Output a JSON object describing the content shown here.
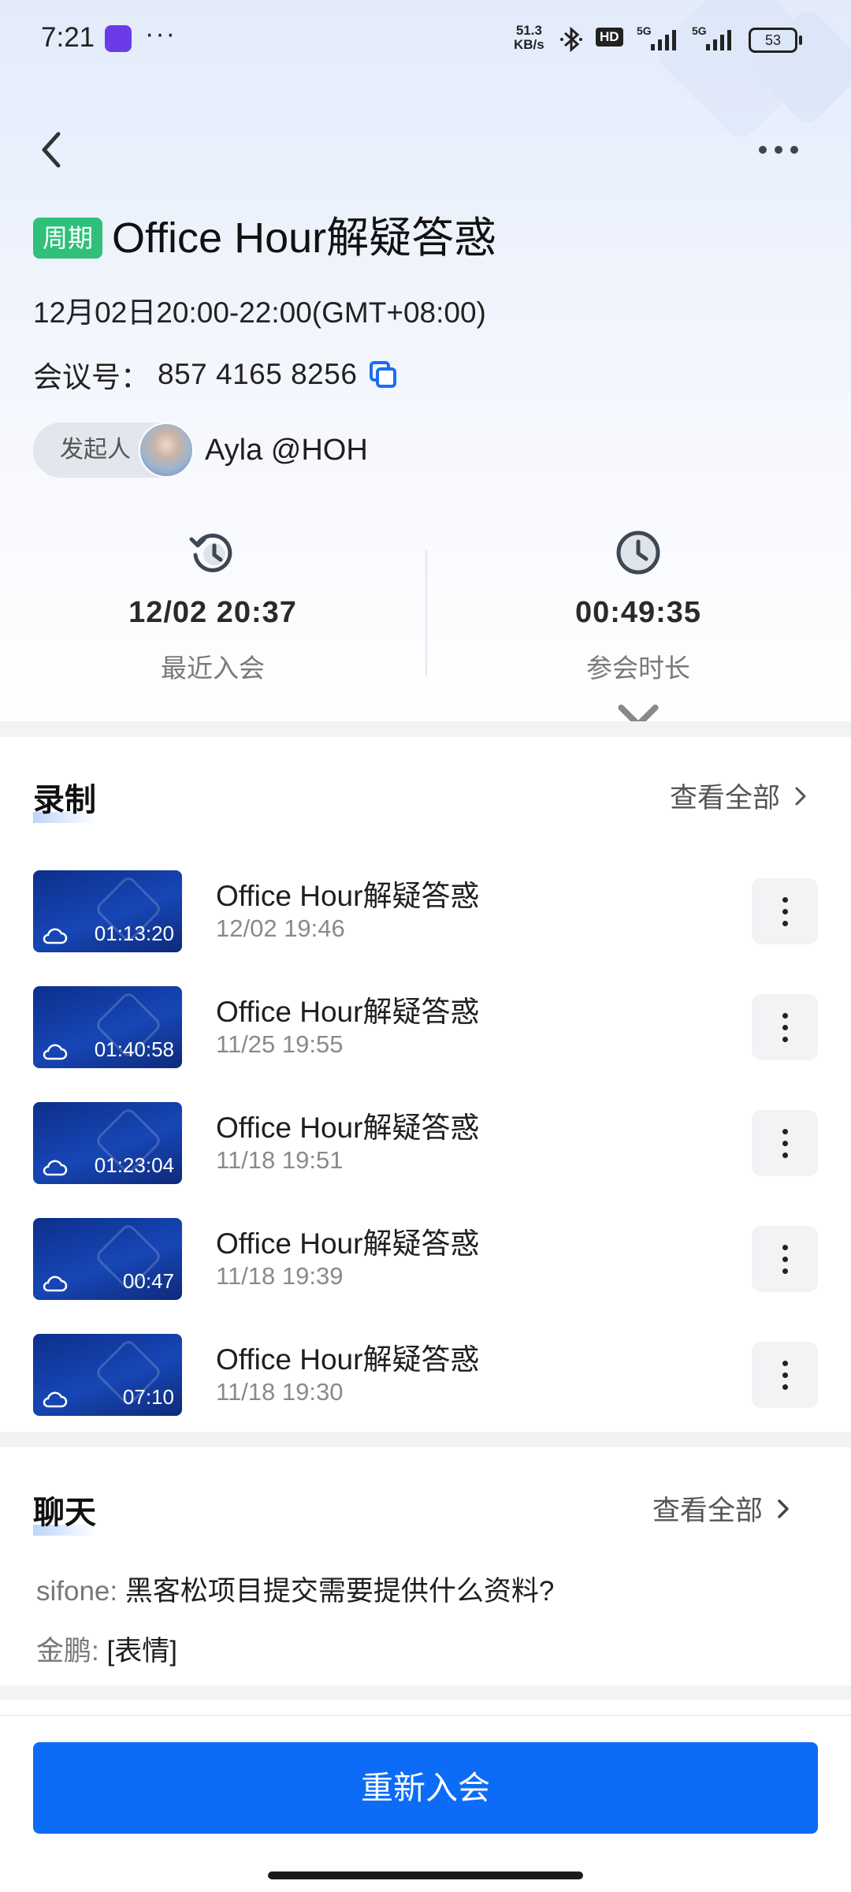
{
  "status_bar": {
    "time": "7:21",
    "more": "···",
    "net_speed_value": "51.3",
    "net_speed_unit": "KB/s",
    "hd": "HD",
    "sim1": "5G",
    "sim2": "5G",
    "battery": "53"
  },
  "header": {
    "back_icon": "chevron-left-icon",
    "more_icon": "more-horizontal-icon"
  },
  "meeting": {
    "tag": "周期",
    "title": "Office Hour解疑答惑",
    "time": "12月02日20:00-22:00(GMT+08:00)",
    "meeting_id_label": "会议号：",
    "meeting_id": "857 4165 8256",
    "host_label": "发起人",
    "host_name": "Ayla @HOH"
  },
  "stats": {
    "recent_join_value": "12/02 20:37",
    "recent_join_label": "最近入会",
    "duration_value": "00:49:35",
    "duration_label": "参会时长"
  },
  "recordings": {
    "title": "录制",
    "view_all": "查看全部",
    "items": [
      {
        "title": "Office Hour解疑答惑",
        "date": "12/02 19:46",
        "duration": "01:13:20"
      },
      {
        "title": "Office Hour解疑答惑",
        "date": "11/25 19:55",
        "duration": "01:40:58"
      },
      {
        "title": "Office Hour解疑答惑",
        "date": "11/18 19:51",
        "duration": "01:23:04"
      },
      {
        "title": "Office Hour解疑答惑",
        "date": "11/18 19:39",
        "duration": "00:47"
      },
      {
        "title": "Office Hour解疑答惑",
        "date": "11/18 19:30",
        "duration": "07:10"
      }
    ]
  },
  "chat": {
    "title": "聊天",
    "view_all": "查看全部",
    "messages": [
      {
        "sender": "sifone:",
        "text": "黑客松项目提交需要提供什么资料?"
      },
      {
        "sender": "金鹏:",
        "text": "[表情]"
      }
    ]
  },
  "actions": {
    "rejoin": "重新入会"
  },
  "colors": {
    "accent": "#0d6cf7",
    "tag_green": "#2fc07a"
  }
}
